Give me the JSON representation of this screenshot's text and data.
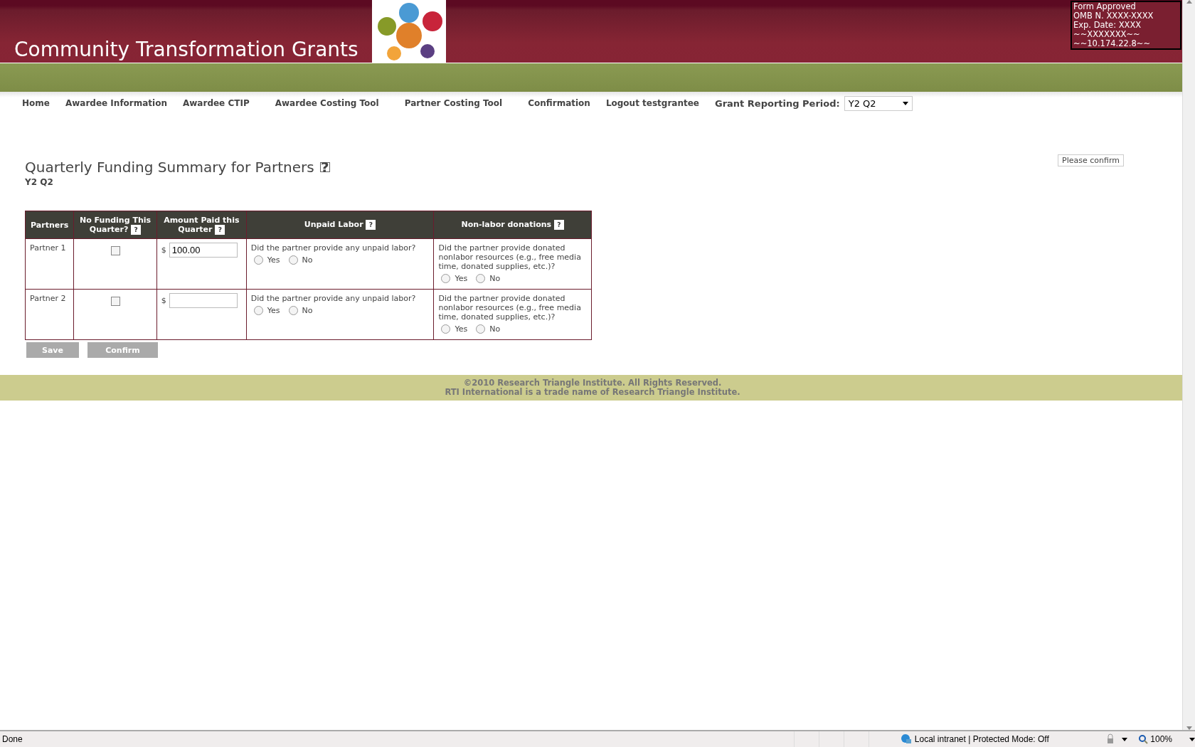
{
  "header": {
    "title": "Community Transformation Grants",
    "notice": [
      "Form Approved",
      "OMB N. XXXX-XXXX",
      "Exp. Date: XXXX",
      "~~XXXXXXX~~",
      "~~10.174.22.8~~"
    ]
  },
  "nav": {
    "items": [
      "Home",
      "Awardee Information",
      "Awardee CTIP",
      "Awardee Costing Tool",
      "Partner Costing Tool",
      "Confirmation",
      "Logout testgrantee"
    ],
    "period_label": "Grant Reporting Period:",
    "period_value": "Y2 Q2"
  },
  "page": {
    "title": "Quarterly Funding Summary for Partners",
    "title_help": "?",
    "subtitle": "Y2 Q2",
    "confirm_note": "Please confirm"
  },
  "table": {
    "columns": [
      {
        "label": "Partners"
      },
      {
        "label": "No Funding This Quarter?",
        "help": "?"
      },
      {
        "label": "Amount Paid this Quarter",
        "help": "?"
      },
      {
        "label": "Unpaid Labor",
        "help": "?"
      },
      {
        "label": "Non-labor donations",
        "help": "?"
      }
    ],
    "rows": [
      {
        "partner": "Partner 1",
        "no_funding": false,
        "currency": "$",
        "amount": "100.00",
        "labor_question": "Did the partner provide any unpaid labor?",
        "labor_options": [
          {
            "label": "Yes",
            "selected": false
          },
          {
            "label": "No",
            "selected": false
          }
        ],
        "donation_question": "Did the partner provide donated nonlabor resources (e.g., free media time, donated supplies, etc.)?",
        "donation_options": [
          {
            "label": "Yes",
            "selected": false
          },
          {
            "label": "No",
            "selected": false
          }
        ]
      },
      {
        "partner": "Partner 2",
        "no_funding": false,
        "currency": "$",
        "amount": "",
        "labor_question": "Did the partner provide any unpaid labor?",
        "labor_options": [
          {
            "label": "Yes",
            "selected": false
          },
          {
            "label": "No",
            "selected": false
          }
        ],
        "donation_question": "Did the partner provide donated nonlabor resources (e.g., free media time, donated supplies, etc.)?",
        "donation_options": [
          {
            "label": "Yes",
            "selected": false
          },
          {
            "label": "No",
            "selected": false
          }
        ]
      }
    ]
  },
  "buttons": [
    "Save",
    "Confirm"
  ],
  "footer": [
    "©2010 Research Triangle Institute. All Rights Reserved.",
    "RTI International is a trade name of Research Triangle Institute."
  ],
  "status_bar": {
    "status": "Done",
    "zone": "Local intranet | Protected Mode: Off",
    "zoom": "100%"
  }
}
